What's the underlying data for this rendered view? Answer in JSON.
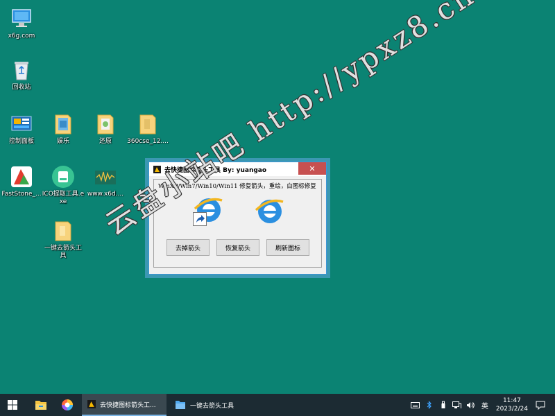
{
  "desktop": {
    "icons": [
      {
        "label": "x6g.com"
      },
      {
        "label": "回收站"
      },
      {
        "label": "控制面板"
      },
      {
        "label": "娱乐"
      },
      {
        "label": "还原"
      },
      {
        "label": "360cse_12...."
      },
      {
        "label": "FastStone_..."
      },
      {
        "label": "ICO提取工具.exe"
      },
      {
        "label": "www.x6d...."
      },
      {
        "label": "一键去箭头工具"
      }
    ]
  },
  "dialog": {
    "title": "去快捷图标箭头工具  By: yuangao",
    "close_glyph": "✕",
    "description": "WinXP/Win7/Win10/Win11 修复箭头，重绘，白图标修复",
    "buttons": {
      "remove": "去掉箭头",
      "restore": "恢复箭头",
      "refresh": "刷新图标"
    }
  },
  "watermark": "云盘小站吧 http://ypxz8.cn",
  "taskbar": {
    "apps": [
      {
        "label": "去快捷图标箭头工..."
      },
      {
        "label": "一键去箭头工具"
      }
    ],
    "ime": "英",
    "clock_time": "11:47",
    "clock_date": "2023/2/24"
  },
  "colors": {
    "desktop_bg": "#0b8373",
    "taskbar_bg": "#1c2b33",
    "window_border": "#3d95d8",
    "close_red": "#c75050"
  }
}
